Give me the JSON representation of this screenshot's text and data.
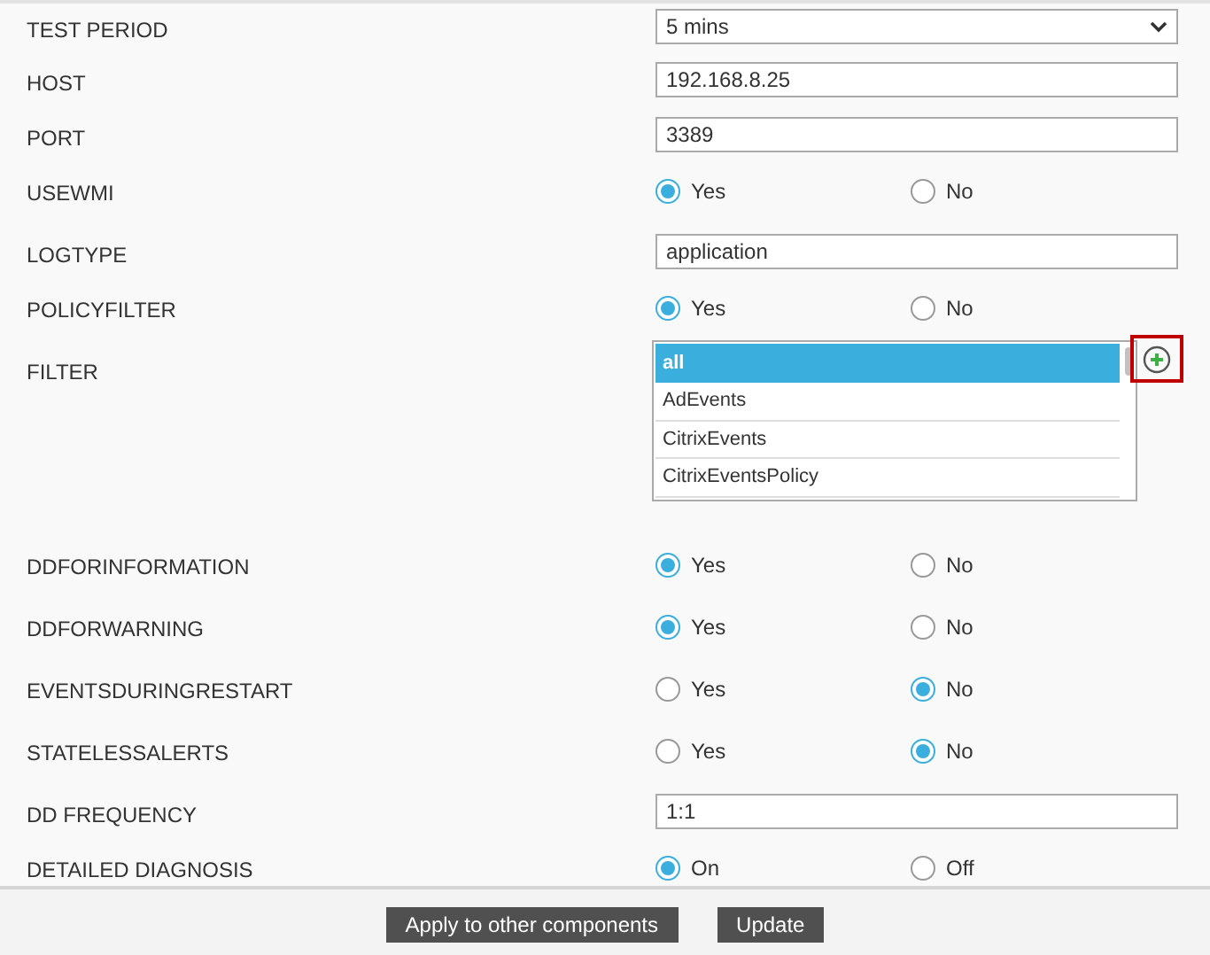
{
  "rows": [
    {
      "kind": "select",
      "label": "TEST PERIOD",
      "value": "5 mins"
    },
    {
      "kind": "text",
      "label": "HOST",
      "value": "192.168.8.25"
    },
    {
      "kind": "text",
      "label": "PORT",
      "value": "3389"
    },
    {
      "kind": "radio",
      "label": "USEWMI",
      "options": [
        {
          "label": "Yes",
          "selected": true
        },
        {
          "label": "No",
          "selected": false
        }
      ]
    },
    {
      "kind": "text",
      "label": "LOGTYPE",
      "value": "application"
    },
    {
      "kind": "radio",
      "label": "POLICYFILTER",
      "options": [
        {
          "label": "Yes",
          "selected": true
        },
        {
          "label": "No",
          "selected": false
        }
      ]
    },
    {
      "kind": "list",
      "label": "FILTER",
      "items": [
        {
          "label": "all",
          "selected": true
        },
        {
          "label": "AdEvents",
          "selected": false
        },
        {
          "label": "CitrixEvents",
          "selected": false
        },
        {
          "label": "CitrixEventsPolicy",
          "selected": false
        }
      ]
    },
    {
      "kind": "radio",
      "label": "DDFORINFORMATION",
      "options": [
        {
          "label": "Yes",
          "selected": true
        },
        {
          "label": "No",
          "selected": false
        }
      ]
    },
    {
      "kind": "radio",
      "label": "DDFORWARNING",
      "options": [
        {
          "label": "Yes",
          "selected": true
        },
        {
          "label": "No",
          "selected": false
        }
      ]
    },
    {
      "kind": "radio",
      "label": "EVENTSDURINGRESTART",
      "options": [
        {
          "label": "Yes",
          "selected": false
        },
        {
          "label": "No",
          "selected": true
        }
      ]
    },
    {
      "kind": "radio",
      "label": "STATELESSALERTS",
      "options": [
        {
          "label": "Yes",
          "selected": false
        },
        {
          "label": "No",
          "selected": true
        }
      ]
    },
    {
      "kind": "text",
      "label": "DD FREQUENCY",
      "value": "1:1"
    },
    {
      "kind": "radio",
      "label": "DETAILED DIAGNOSIS",
      "options": [
        {
          "label": "On",
          "selected": true
        },
        {
          "label": "Off",
          "selected": false
        }
      ]
    }
  ],
  "buttons": [
    "Apply to other components",
    "Update"
  ]
}
